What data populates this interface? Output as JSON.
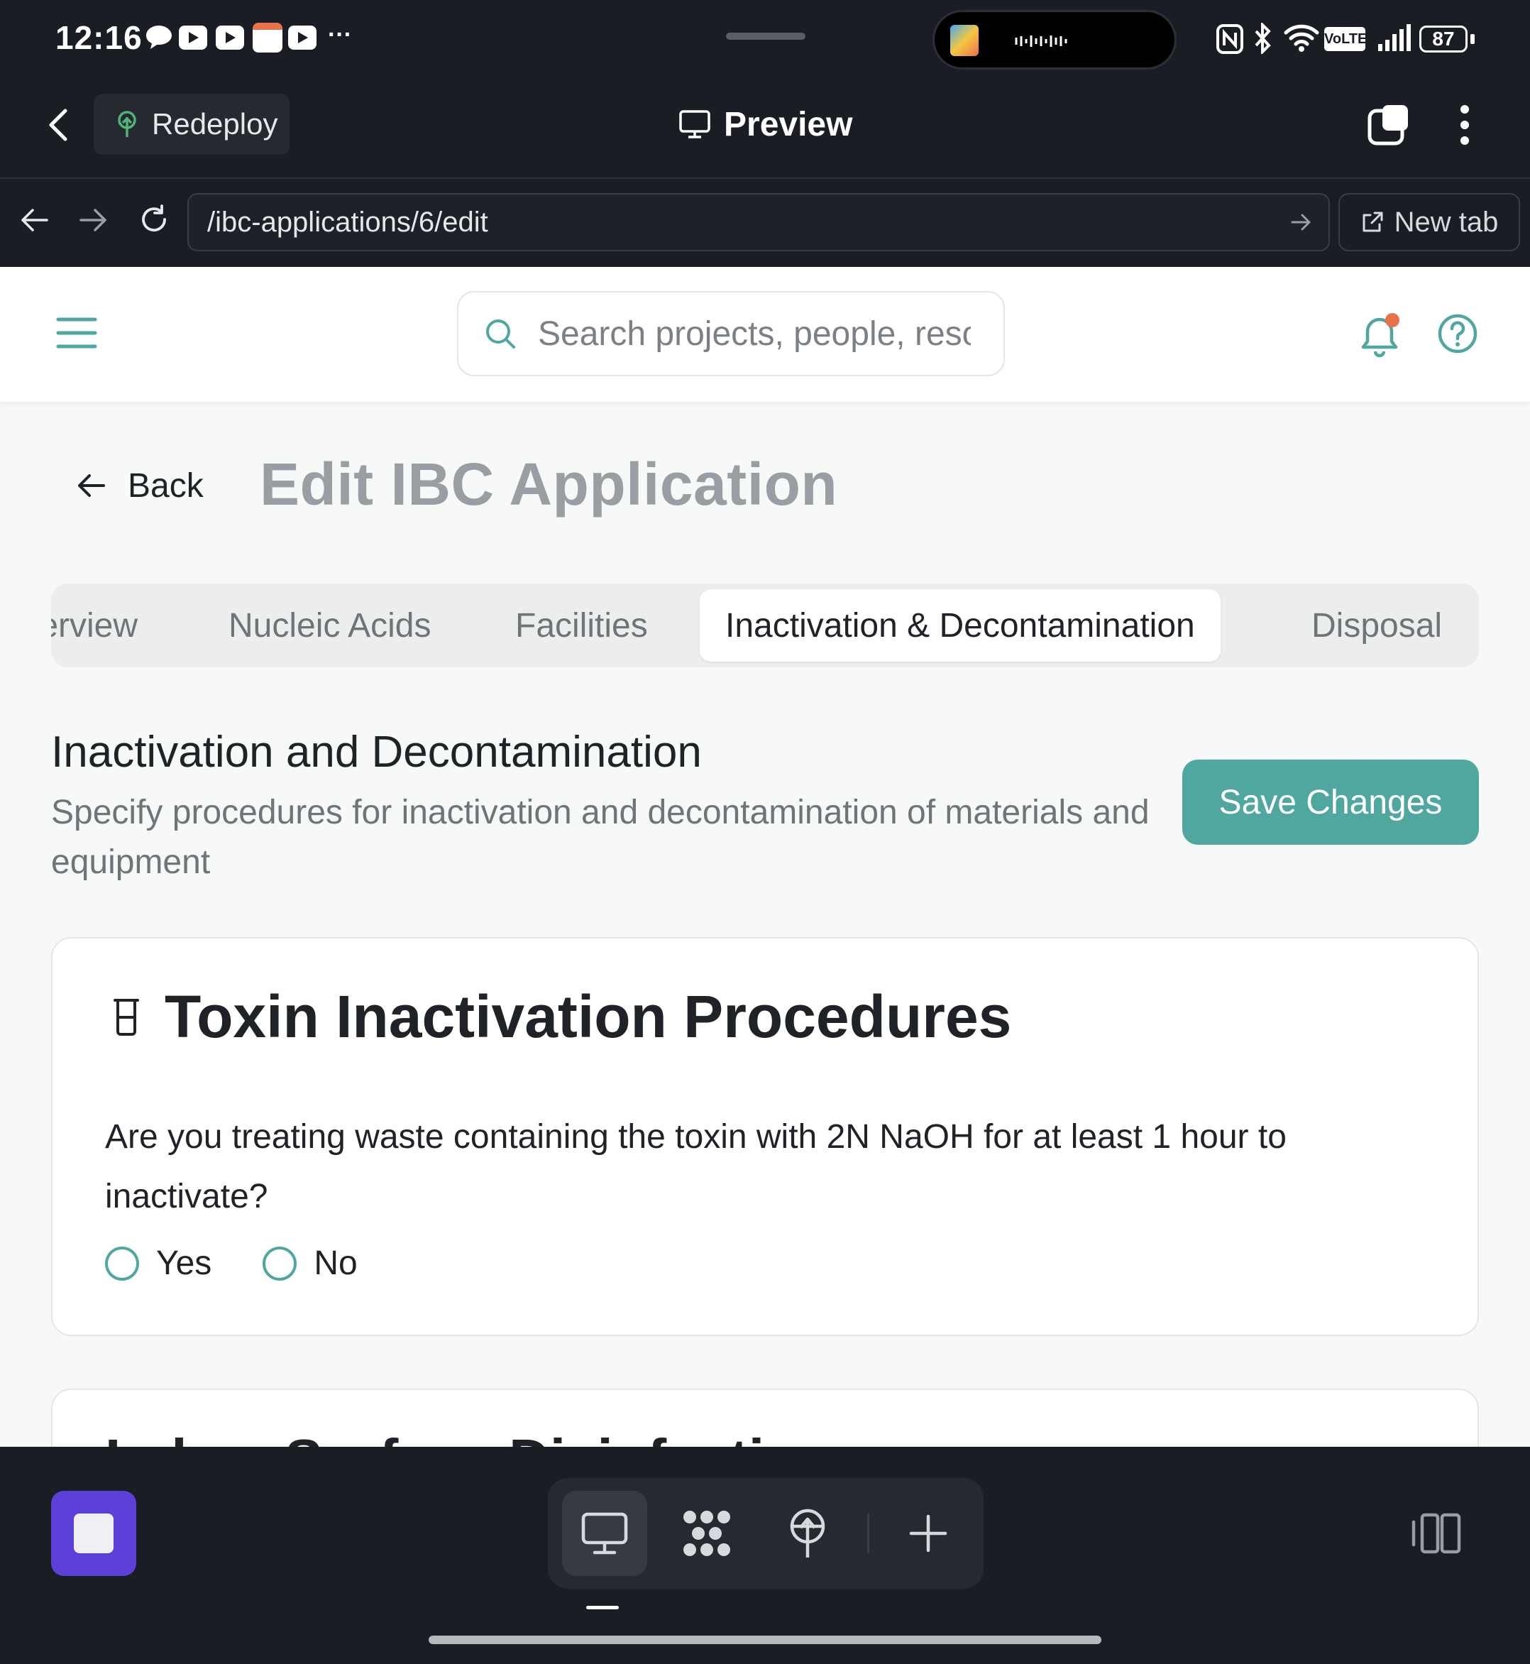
{
  "status_bar": {
    "time": "12:16",
    "battery": "87",
    "network_label": "VoLTE",
    "more": "···"
  },
  "app_header": {
    "redeploy_label": "Redeploy",
    "title": "Preview"
  },
  "browser": {
    "url": "/ibc-applications/6/edit",
    "new_tab_label": "New tab"
  },
  "web_header": {
    "search_placeholder": "Search projects, people, resources"
  },
  "page": {
    "back_label": "Back",
    "title": "Edit IBC Application",
    "tabs": [
      {
        "label": "Overview",
        "active": false
      },
      {
        "label": "Nucleic Acids",
        "active": false
      },
      {
        "label": "Facilities",
        "active": false
      },
      {
        "label": "Inactivation & Decontamination",
        "active": true
      },
      {
        "label": "Disposal",
        "active": false
      }
    ],
    "section": {
      "title": "Inactivation and Decontamination",
      "description": "Specify procedures for inactivation and decontamination of materials and equipment",
      "save_label": "Save Changes"
    },
    "cards": [
      {
        "title": "Toxin Inactivation Procedures",
        "question": "Are you treating waste containing the toxin with 2N NaOH for at least 1 hour to inactivate?",
        "options": [
          "Yes",
          "No"
        ]
      },
      {
        "title": "Lab ... Surface Disinfection"
      }
    ]
  },
  "colors": {
    "accent": "#4fa79f",
    "dark_bg": "#1b1d24",
    "stop_button": "#5b3fd6",
    "notification_dot": "#e8734a"
  }
}
